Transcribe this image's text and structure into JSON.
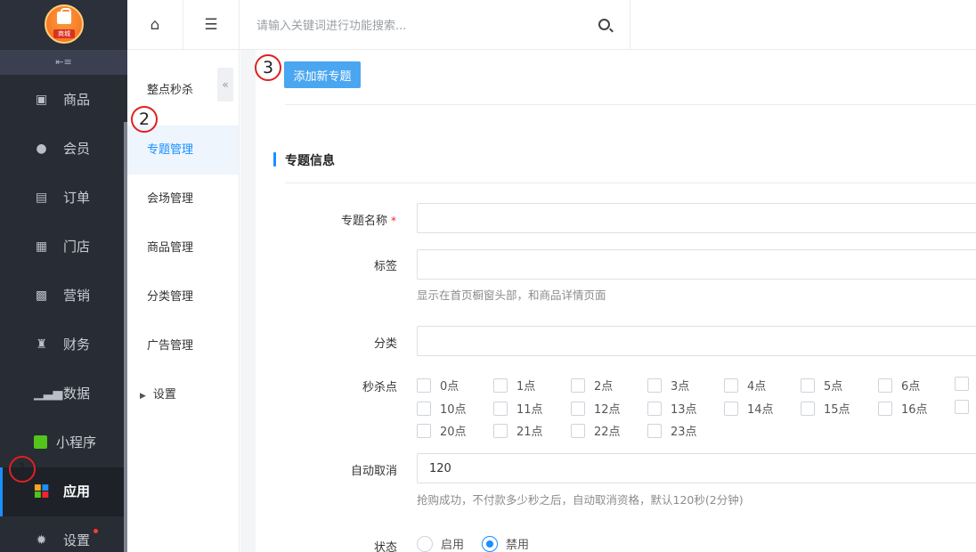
{
  "sidebar": {
    "logo_badge": "商城",
    "collapse_icon": "collapse-menu-icon",
    "items": [
      {
        "label": "商品",
        "icon": "goods-icon"
      },
      {
        "label": "会员",
        "icon": "user-icon"
      },
      {
        "label": "订单",
        "icon": "order-icon"
      },
      {
        "label": "门店",
        "icon": "store-icon"
      },
      {
        "label": "营销",
        "icon": "gift-icon"
      },
      {
        "label": "财务",
        "icon": "money-bag-icon"
      },
      {
        "label": "数据",
        "icon": "chart-icon"
      },
      {
        "label": "小程序",
        "icon": "mini-program-icon"
      },
      {
        "label": "应用",
        "icon": "apps-icon",
        "active": true
      },
      {
        "label": "设置",
        "icon": "settings-icon"
      }
    ]
  },
  "subnav": {
    "title": "整点秒杀",
    "items": [
      {
        "label": "专题管理",
        "active": true
      },
      {
        "label": "会场管理"
      },
      {
        "label": "商品管理"
      },
      {
        "label": "分类管理"
      },
      {
        "label": "广告管理"
      },
      {
        "label": "设置",
        "expandable": true
      }
    ]
  },
  "header": {
    "search_placeholder": "请输入关键词进行功能搜索..."
  },
  "main": {
    "add_button_label": "添加新专题",
    "section_title": "专题信息",
    "fields": {
      "name_label": "专题名称",
      "required_mark": "*",
      "tag_label": "标签",
      "tag_hint": "显示在首页橱窗头部，和商品详情页面",
      "category_label": "分类",
      "seckill_label": "秒杀点",
      "seckill_hours": [
        "0点",
        "1点",
        "2点",
        "3点",
        "4点",
        "5点",
        "6点",
        "10点",
        "11点",
        "12点",
        "13点",
        "14点",
        "15点",
        "16点",
        "20点",
        "21点",
        "22点",
        "23点"
      ],
      "auto_cancel_label": "自动取消",
      "auto_cancel_value": "120",
      "auto_cancel_hint": "抢购成功，不付款多少秒之后，自动取消资格，默认120秒(2分钟)",
      "status_label": "状态",
      "status_on": "启用",
      "status_off": "禁用",
      "status_selected": "禁用"
    }
  },
  "annotations": [
    "1",
    "2",
    "3"
  ],
  "colors": {
    "sidebar_bg": "#282c34",
    "accent": "#1890ff",
    "primary_button": "#4aa6f0",
    "annotation": "#e02020"
  }
}
